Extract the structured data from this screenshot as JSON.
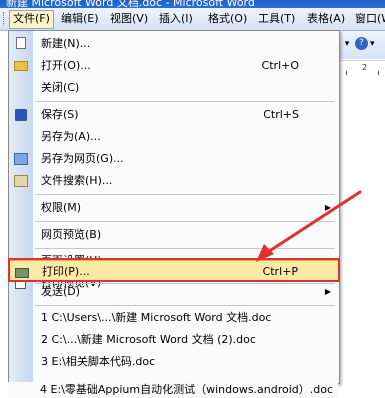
{
  "window": {
    "title": "新建 Microsoft Word 文档.doc - Microsoft Word"
  },
  "menubar": [
    {
      "label": "文件(F)",
      "active": true
    },
    {
      "label": "编辑(E)"
    },
    {
      "label": "视图(V)"
    },
    {
      "label": "插入(I)"
    },
    {
      "label": "格式(O)"
    },
    {
      "label": "工具(T)"
    },
    {
      "label": "表格(A)"
    },
    {
      "label": "窗口(W)"
    }
  ],
  "toolbar": {
    "dropdown_glyph": "▾",
    "help_glyph": "?",
    "ruler_tick": "2"
  },
  "file_menu": {
    "items": [
      {
        "label": "新建(N)...",
        "shortcut": "",
        "icon": "new-document-icon"
      },
      {
        "label": "打开(O)...",
        "shortcut": "Ctrl+O",
        "icon": "open-folder-icon"
      },
      {
        "label": "关闭(C)",
        "shortcut": "",
        "icon": ""
      },
      {
        "label": "保存(S)",
        "shortcut": "Ctrl+S",
        "icon": "save-icon"
      },
      {
        "label": "另存为(A)...",
        "shortcut": "",
        "icon": ""
      },
      {
        "label": "另存为网页(G)...",
        "shortcut": "",
        "icon": "save-as-web-icon"
      },
      {
        "label": "文件搜索(H)...",
        "shortcut": "",
        "icon": "file-search-icon"
      },
      {
        "label": "权限(M)",
        "shortcut": "",
        "submenu": true
      },
      {
        "label": "网页预览(B)",
        "shortcut": ""
      },
      {
        "label": "页面设置(U)...",
        "shortcut": ""
      },
      {
        "label": "打印预览(V)",
        "shortcut": "",
        "icon": "print-preview-icon"
      },
      {
        "label": "打印(P)...",
        "shortcut": "Ctrl+P",
        "icon": "print-icon",
        "highlighted": true
      },
      {
        "label": "发送(D)",
        "shortcut": "",
        "submenu": true
      }
    ],
    "recent_files": [
      "1 C:\\Users\\...\\新建 Microsoft Word 文档.doc",
      "2 C:\\...\\新建 Microsoft Word 文档 (2).doc",
      "3 E:\\相关脚本代码.doc",
      "4 E:\\零基础Appium自动化测试（windows.android）.doc"
    ],
    "submenu_arrow": "▶"
  },
  "colors": {
    "highlight_bg": "#fde9a6",
    "annotation_red": "#e03030"
  }
}
